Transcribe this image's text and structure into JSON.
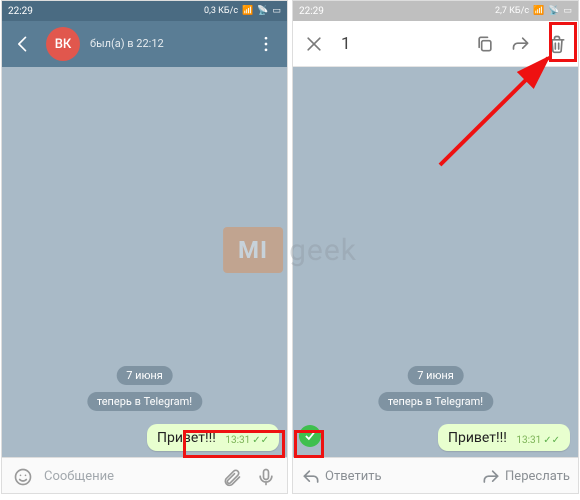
{
  "status": {
    "time": "22:29",
    "netL": "0,3 КБ/с",
    "netR": "2,7 КБ/с"
  },
  "left": {
    "avatar": "ВК",
    "name": "",
    "sub": "был(а) в 22:12"
  },
  "right": {
    "count": "1"
  },
  "chat": {
    "date": "7 июня",
    "system": "теперь в Telegram!",
    "msg": "Привет!!!",
    "msg_time": "13:31"
  },
  "input": {
    "placeholder": "Сообщение",
    "reply": "Ответить",
    "forward": "Переслать"
  },
  "watermark": {
    "logo": "MI",
    "text": "geek"
  }
}
